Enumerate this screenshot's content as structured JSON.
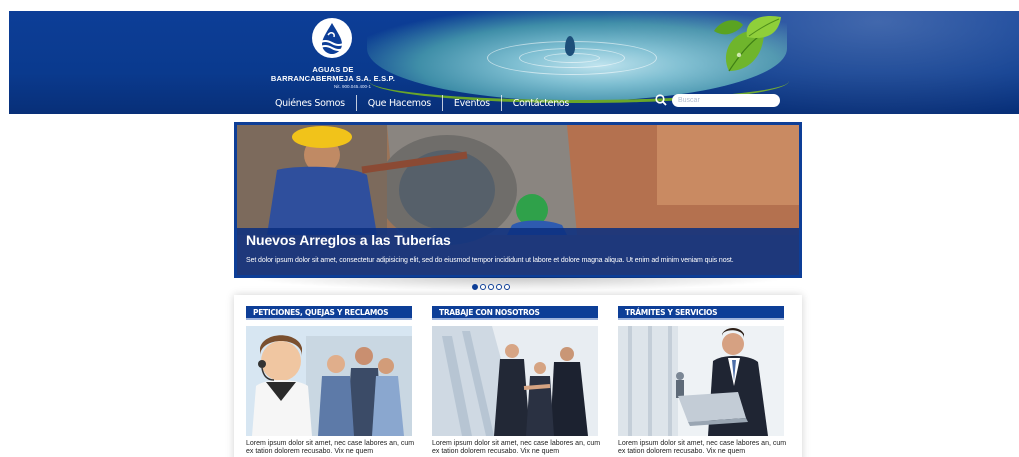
{
  "header": {
    "company_line1": "AGUAS DE",
    "company_line2": "BARRANCABERMEJA S.A. E.S.P.",
    "nit": "Nit. 900.045.400-1",
    "nav": [
      {
        "label": "Quiénes Somos"
      },
      {
        "label": "Que Hacemos"
      },
      {
        "label": "Eventos"
      },
      {
        "label": "Contáctenos"
      }
    ],
    "search": {
      "placeholder": "Buscar",
      "icon": "search-icon"
    }
  },
  "slider": {
    "title": "Nuevos Arreglos a las Tuberías",
    "text": "Set dolor ipsum dolor sit amet, consectetur adipisicing elit, sed do eiusmod tempor incididunt ut labore et dolore magna aliqua. Ut enim ad minim veniam quis nost.",
    "dots_total": 5,
    "active_dot": 1
  },
  "cards": [
    {
      "title": "PETICIONES, QUEJAS Y RECLAMOS",
      "text": "Lorem ipsum dolor sit amet, nec case labores an, cum ex tation dolorem recusabo. Vix ne quem"
    },
    {
      "title": "TRABAJE CON NOSOTROS",
      "text": "Lorem ipsum dolor sit amet, nec case labores an, cum ex tation dolorem recusabo. Vix ne quem"
    },
    {
      "title": "TRÁMITES Y SERVICIOS",
      "text": "Lorem ipsum dolor sit amet, nec case labores an, cum ex tation dolorem recusabo. Vix ne quem"
    }
  ],
  "colors": {
    "brand_blue": "#0d3e97",
    "accent_green": "#6aa629",
    "white": "#ffffff"
  }
}
